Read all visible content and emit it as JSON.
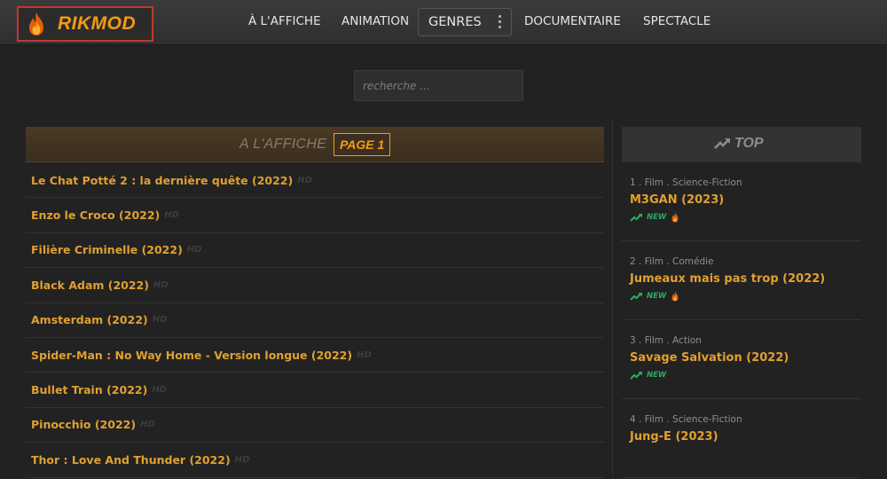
{
  "header": {
    "logo_text": "RIKMOD",
    "nav": [
      {
        "label": "À L'AFFICHE"
      },
      {
        "label": "ANIMATION"
      },
      {
        "label": "GENRES"
      },
      {
        "label": "DOCUMENTAIRE"
      },
      {
        "label": "SPECTACLE"
      }
    ]
  },
  "search": {
    "placeholder": "recherche ..."
  },
  "main": {
    "section_title": "A L'AFFICHE",
    "page_label": "PAGE 1",
    "quality_badge": "HD",
    "movies": [
      "Le Chat Potté 2 : la dernière quête (2022)",
      "Enzo le Croco (2022)",
      "Filière Criminelle (2022)",
      "Black Adam (2022)",
      "Amsterdam (2022)",
      "Spider-Man : No Way Home - Version longue (2022)",
      "Bullet Train (2022)",
      "Pinocchio (2022)",
      "Thor : Love And Thunder (2022)"
    ]
  },
  "sidebar": {
    "title": "TOP",
    "new_label": "NEW",
    "items": [
      {
        "meta": "1 . Film . Science-Fiction",
        "title": "M3GAN (2023)",
        "is_new": true,
        "hot": true
      },
      {
        "meta": "2 . Film . Comédie",
        "title": "Jumeaux mais pas trop (2022)",
        "is_new": true,
        "hot": true
      },
      {
        "meta": "3 . Film . Action",
        "title": "Savage Salvation (2022)",
        "is_new": true,
        "hot": false
      },
      {
        "meta": "4 . Film . Science-Fiction",
        "title": "Jung-E (2023)",
        "is_new": false,
        "hot": false
      }
    ]
  },
  "colors": {
    "accent": "#f39c12",
    "title_text": "#e0a030",
    "logo_border": "#c0392b",
    "new_green": "#27ae60",
    "background": "#222222"
  },
  "icons": {
    "logo": "flame-icon",
    "genres_menu": "vertical-dots-icon",
    "top": "trending-up-icon",
    "new": "trending-up-icon",
    "hot": "flame-icon"
  }
}
